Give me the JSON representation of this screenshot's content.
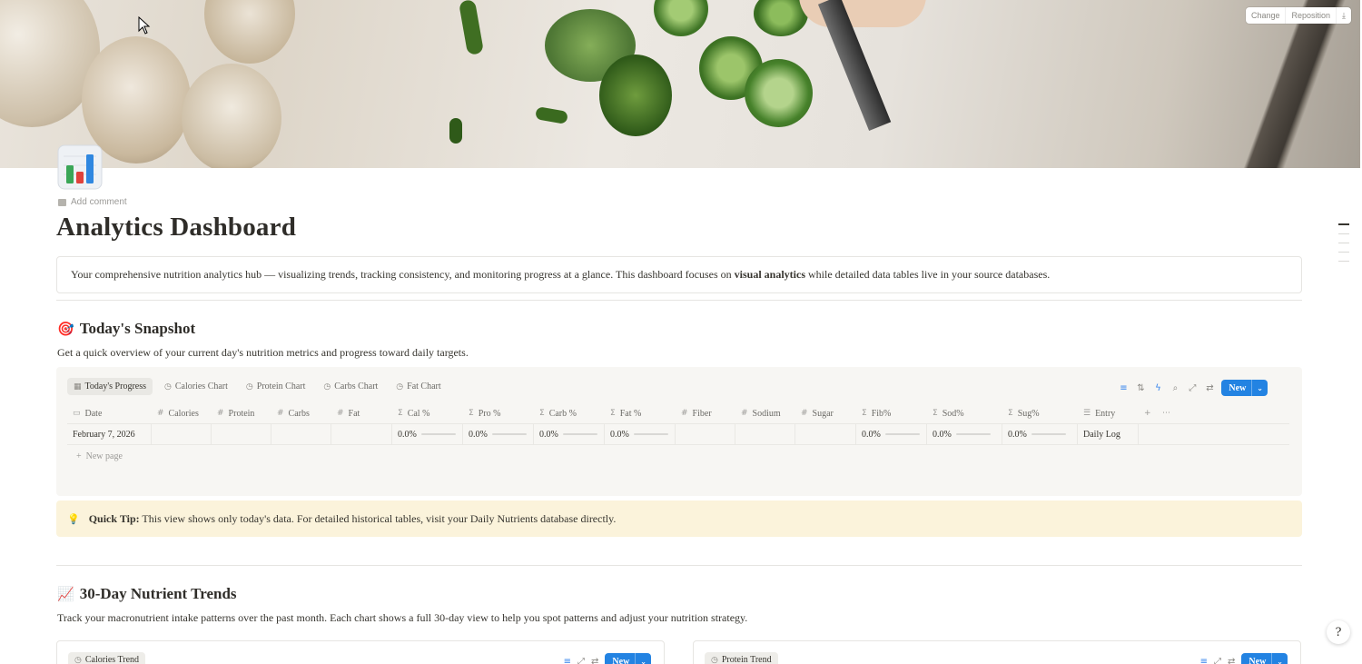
{
  "cover": {
    "controls": [
      "Change",
      "Reposition",
      "⤓"
    ]
  },
  "page": {
    "add_comment": "Add comment",
    "title": "Analytics Dashboard",
    "intro_before": "Your comprehensive nutrition analytics hub — visualizing trends, tracking consistency, and monitoring progress at a glance. This dashboard focuses on ",
    "intro_bold": "visual analytics",
    "intro_after": " while detailed data tables live in your source databases."
  },
  "snapshot": {
    "emoji": "🎯",
    "heading": "Today's Snapshot",
    "description": "Get a quick overview of your current day's nutrition metrics and progress toward daily targets.",
    "tabs": [
      {
        "icon": "table-icon",
        "label": "Today's Progress",
        "active": true
      },
      {
        "icon": "chart-icon",
        "label": "Calories Chart"
      },
      {
        "icon": "chart-icon",
        "label": "Protein Chart"
      },
      {
        "icon": "chart-icon",
        "label": "Carbs Chart"
      },
      {
        "icon": "chart-icon",
        "label": "Fat Chart"
      }
    ],
    "new_label": "New",
    "columns": [
      {
        "icon": "▭",
        "label": "Date"
      },
      {
        "icon": "#",
        "label": "Calories"
      },
      {
        "icon": "#",
        "label": "Protein"
      },
      {
        "icon": "#",
        "label": "Carbs"
      },
      {
        "icon": "#",
        "label": "Fat"
      },
      {
        "icon": "Σ",
        "label": "Cal %"
      },
      {
        "icon": "Σ",
        "label": "Pro %"
      },
      {
        "icon": "Σ",
        "label": "Carb %"
      },
      {
        "icon": "Σ",
        "label": "Fat %"
      },
      {
        "icon": "#",
        "label": "Fiber"
      },
      {
        "icon": "#",
        "label": "Sodium"
      },
      {
        "icon": "#",
        "label": "Sugar"
      },
      {
        "icon": "Σ",
        "label": "Fib%"
      },
      {
        "icon": "Σ",
        "label": "Sod%"
      },
      {
        "icon": "Σ",
        "label": "Sug%"
      },
      {
        "icon": "☰",
        "label": "Entry"
      }
    ],
    "row": {
      "date": "February 7, 2026",
      "cal_pct": "0.0%",
      "pro_pct": "0.0%",
      "carb_pct": "0.0%",
      "fat_pct": "0.0%",
      "fib_pct": "0.0%",
      "sod_pct": "0.0%",
      "sug_pct": "0.0%",
      "entry": "Daily Log"
    },
    "new_page": "New page"
  },
  "tip": {
    "label": "Quick Tip:",
    "text": " This view shows only today's data. For detailed historical tables, visit your Daily Nutrients database directly."
  },
  "trends": {
    "emoji": "📈",
    "heading": "30-Day Nutrient Trends",
    "description": "Track your macronutrient intake patterns over the past month. Each chart shows a full 30-day view to help you spot patterns and adjust your nutrition strategy.",
    "cards": [
      {
        "tab": "Calories Trend",
        "new_label": "New"
      },
      {
        "tab": "Protein Trend",
        "new_label": "New"
      }
    ]
  },
  "colors": {
    "accent": "#2383e2",
    "callout_bg": "#fbf3db",
    "db_bg": "#f7f6f3"
  }
}
